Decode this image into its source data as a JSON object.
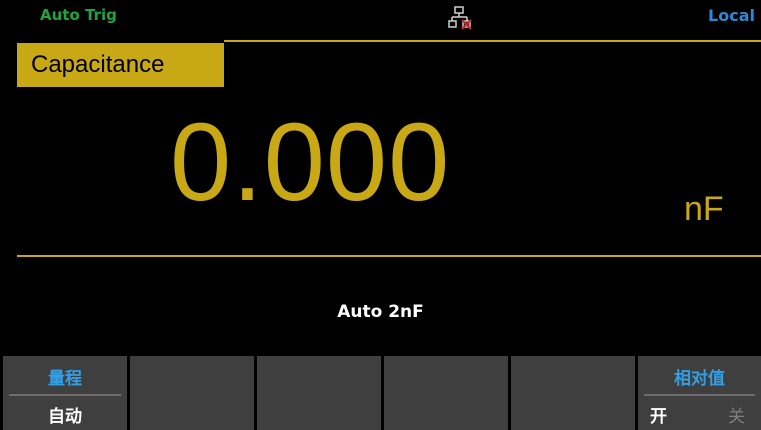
{
  "status": {
    "trigger_mode": "Auto Trig",
    "remote_state": "Local",
    "lan_icon": "network-disconnected-icon"
  },
  "measurement": {
    "function": "Capacitance",
    "value": "0.000",
    "unit": "nF",
    "range": "Auto 2nF"
  },
  "softkeys": {
    "range": {
      "title": "量程",
      "value": "自动"
    },
    "relative": {
      "title": "相对值",
      "on_label": "开",
      "off_label": "关",
      "selected": "开"
    }
  },
  "colors": {
    "accent": "#c8a814",
    "trigger_text": "#1fa53a",
    "softkey_title": "#33a0e6",
    "softkey_bg": "#3f3f3f"
  }
}
